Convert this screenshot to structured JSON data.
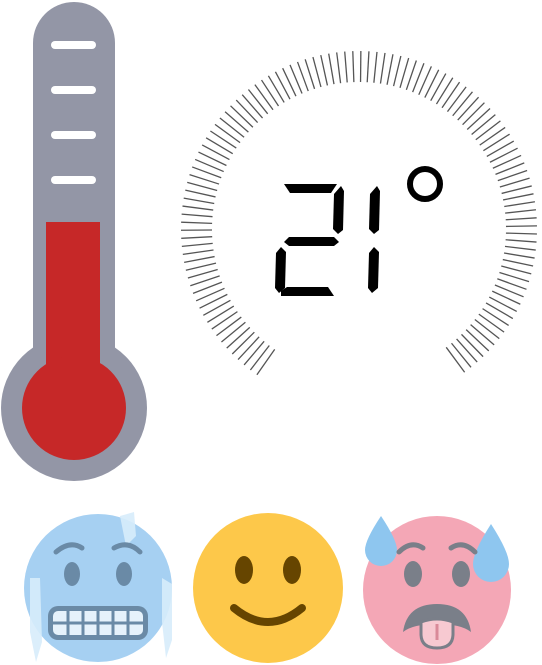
{
  "thermostat": {
    "temperature": "21",
    "unit_symbol": "°",
    "temperature_level": 0.55
  },
  "moods": {
    "items": [
      {
        "id": "cold",
        "icon": "freezing-face-icon"
      },
      {
        "id": "comfortable",
        "icon": "smiling-face-icon"
      },
      {
        "id": "hot",
        "icon": "hot-sweating-face-icon"
      }
    ]
  },
  "colors": {
    "thermometer_body": "#9396a6",
    "mercury": "#c62828",
    "tick_marks": "#555555",
    "cold_face": "#a6d0f2",
    "comfortable_face": "#fdc84a",
    "hot_face": "#f4a7b6",
    "sweat_drop": "#8ec6ef"
  }
}
